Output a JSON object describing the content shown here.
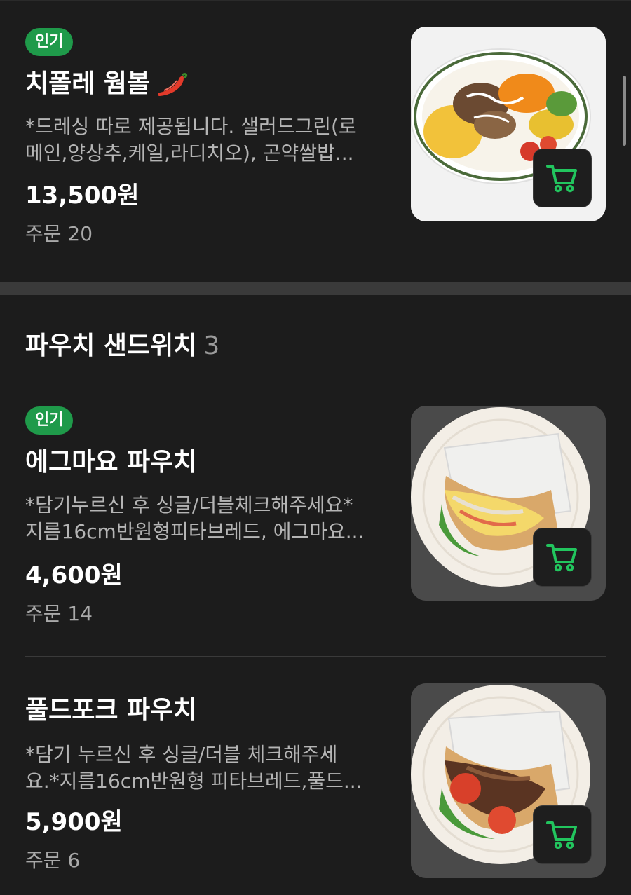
{
  "items": [
    {
      "badge": "인기",
      "name": "치폴레 웜볼",
      "spicy_icon": "chili-pepper-icon",
      "desc_line1": "*드레싱 따로 제공됩니다. 샐러드그린(로",
      "desc_line2": "메인,양상추,케일,라디치오), 곤약쌀밥...",
      "price": "13,500원",
      "orders": "주문 20",
      "image_icon": "salad-bowl-image"
    },
    {
      "badge": "인기",
      "name": "에그마요 파우치",
      "desc_line1": "*담기누르신 후 싱글/더블체크해주세요*",
      "desc_line2": "지름16cm반원형피타브레드, 에그마요...",
      "price": "4,600원",
      "orders": "주문 14",
      "image_icon": "egg-mayo-pita-image"
    },
    {
      "name": "풀드포크 파우치",
      "desc_line1": "*담기 누르신 후 싱글/더블 체크해주세",
      "desc_line2": "요.*지름16cm반원형 피타브레드,풀드...",
      "price": "5,900원",
      "orders": "주문 6",
      "image_icon": "pulled-pork-pita-image"
    }
  ],
  "section": {
    "title": "파우치 샌드위치",
    "count": "3"
  },
  "colors": {
    "background": "#1c1c1c",
    "badge_green": "#1f9a4a",
    "cart_green": "#22c55e",
    "description_gray": "#b5b5b5"
  },
  "icons": {
    "cart": "shopping-cart-icon"
  }
}
